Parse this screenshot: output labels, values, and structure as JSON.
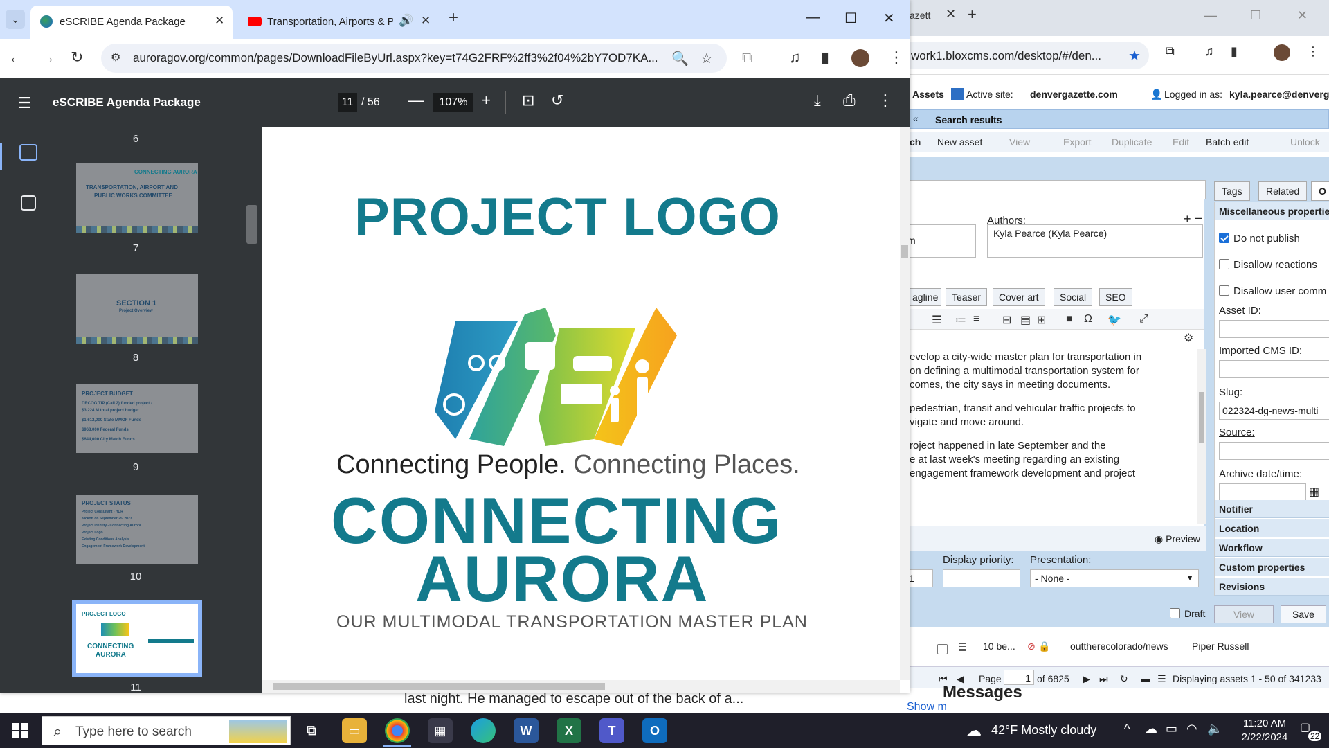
{
  "cms": {
    "tab_fragment": "azett",
    "url": "work1.bloxcms.com/desktop/#/den...",
    "assets_label": "Assets",
    "active_site_label": "Active site:",
    "active_site_value": "denvergazette.com",
    "logged_in_label": "Logged in as:",
    "logged_in_value": "kyla.pearce@denvergazette.c",
    "tab_fragment_left": "ch",
    "search_results_title": "Search results",
    "toolbar": {
      "new_asset": "New asset",
      "view": "View",
      "export": "Export",
      "duplicate": "Duplicate",
      "edit": "Edit",
      "batch_edit": "Batch edit",
      "unlock": "Unlock"
    },
    "authors_label": "Authors:",
    "author_value": "Kyla Pearce (Kyla Pearce)",
    "field_fragment": "m",
    "editor_tabs": [
      "agline",
      "Teaser",
      "Cover art",
      "Social",
      "SEO"
    ],
    "editor_lines": [
      "evelop a city-wide master plan for transportation in",
      "on defining a multimodal transportation system for",
      "comes, the city says in meeting documents.",
      "pedestrian, transit and vehicular traffic projects to",
      "vigate and move around.",
      "roject happened in late September and the",
      "e at last week's meeting regarding an existing",
      "engagement framework development and project"
    ],
    "preview_label": "Preview",
    "display_priority_label": "Display priority:",
    "presentation_label": "Presentation:",
    "presentation_value": "- None -",
    "priority_fragment": "1",
    "draft_label": "Draft",
    "view_button": "View",
    "save_button": "Save",
    "right_tabs": [
      "Tags",
      "Related",
      "O"
    ],
    "misc_heading": "Miscellaneous propertie",
    "do_not_publish": "Do not publish",
    "disallow_reactions": "Disallow reactions",
    "disallow_user_comm": "Disallow user comm",
    "asset_id_label": "Asset ID:",
    "imported_cms_id_label": "Imported CMS ID:",
    "slug_label": "Slug:",
    "slug_value": "022324-dg-news-multi",
    "source_label": "Source:",
    "archive_label": "Archive date/time:",
    "accordions": [
      "Notifier",
      "Location",
      "Workflow",
      "Custom properties",
      "Revisions"
    ],
    "list_row": {
      "title": "10 be...",
      "section": "outtherecolorado/news",
      "author": "Piper Russell"
    },
    "pager": {
      "page_label": "Page",
      "page_value": "1",
      "of_label": "of 6825",
      "displaying": "Displaying assets 1 - 50 of 341233"
    },
    "messages_title": "Messages",
    "show_more": "Show m"
  },
  "background_news_text": "last night. He managed to escape out of the back of a...",
  "browser": {
    "tabs": [
      {
        "title": "eSCRIBE Agenda Package"
      },
      {
        "title": "Transportation, Airports & P"
      }
    ],
    "url": "auroragov.org/common/pages/DownloadFileByUrl.aspx?key=t74G2FRF%2ff3%2f04%2bY7OD7KA..."
  },
  "pdf": {
    "title": "eSCRIBE Agenda Package",
    "current_page": "11",
    "page_total": "/ 56",
    "zoom": "107%",
    "thumbnails": [
      {
        "num": "6",
        "lines": [
          "CONNECTING AURORA",
          "TRANSPORTATION, AIRPORT AND",
          "PUBLIC WORKS COMMITTEE"
        ]
      },
      {
        "num": "7",
        "lines": [
          "SECTION 1",
          "Project Overview"
        ]
      },
      {
        "num": "8",
        "lines": [
          "PROJECT BUDGET",
          "DRCOG TIP (Call 2) funded project -",
          "$3.224 M total project budget",
          "$1,612,000 State MMOF Funds",
          "$968,000 Federal Funds",
          "$644,000 City Match Funds"
        ]
      },
      {
        "num": "9",
        "lines": [
          "PROJECT STATUS",
          "Project Consultant - HDR",
          "Kickoff on September 25, 2023",
          "Project Identity - Connecting Aurora",
          "Project Logo",
          "Existing Conditions Analysis",
          "Engagement Framework Development"
        ]
      },
      {
        "num": "10",
        "lines": [
          "PROJECT LOGO",
          "CONNECTING",
          "AURORA"
        ]
      },
      {
        "num": "11",
        "lines": []
      }
    ],
    "page": {
      "heading": "PROJECT LOGO",
      "tagline_a": "Connecting People.",
      "tagline_b": "Connecting Places.",
      "brand_line1": "CONNECTING",
      "brand_line2": "AURORA",
      "subline": "OUR MULTIMODAL TRANSPORTATION MASTER PLAN"
    }
  },
  "taskbar": {
    "search_placeholder": "Type here to search",
    "weather": "42°F  Mostly cloudy",
    "time": "11:20 AM",
    "date": "2/22/2024",
    "notification_count": "22"
  },
  "colors": {
    "brand_teal": "#137a8c",
    "pdf_dark": "#323639",
    "tabstrip": "#d3e3fd"
  }
}
